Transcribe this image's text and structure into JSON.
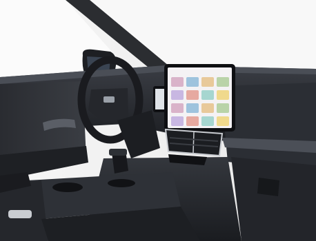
{
  "photo": {
    "subject": "car-interior",
    "colors": {
      "background": "#f3f3f3",
      "dashboard": "#2a2d33",
      "dashboard_dark": "#1a1c20",
      "trim_silver": "#c9ccd1",
      "screen_bezel": "#0e0f12",
      "screen_tiles": [
        "#d9b3c9",
        "#9ec3dd",
        "#e8c99a",
        "#b9d3a8",
        "#c8b7e2",
        "#e6a9a0",
        "#a6d6d0",
        "#f0d98c"
      ]
    }
  }
}
